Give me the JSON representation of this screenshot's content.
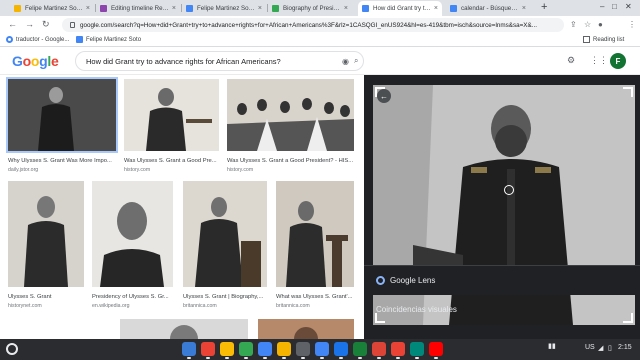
{
  "browser": {
    "tabs": [
      {
        "title": "Felipe Martinez Soto - Lo",
        "favicon_color": "#f4b400",
        "active": false
      },
      {
        "title": "Editing timeline Recons",
        "favicon_color": "#8e44ad",
        "active": false
      },
      {
        "title": "Felipe Martinez Soto - G",
        "favicon_color": "#4285f4",
        "active": false
      },
      {
        "title": "Biography of President",
        "favicon_color": "#34a853",
        "active": false
      },
      {
        "title": "How did Grant try to adv",
        "favicon_color": "#4285f4",
        "active": true
      },
      {
        "title": "calendar - Búsqueda de",
        "favicon_color": "#4285f4",
        "active": false
      }
    ],
    "new_tab_symbol": "+",
    "url": "google.com/search?q=How+did+Grant+try+to+advance+rights+for+African+Americans%3F&rlz=1CASQGI_enUS924&hl=es-419&tbm=isch&source=lnms&sa=X&...",
    "reading_list": "Reading list",
    "bookmarks": [
      {
        "label": "traductor - Google...",
        "icon_color": "#4285f4"
      },
      {
        "label": "Felipe Martinez Soto",
        "icon_color": "#4285f4"
      }
    ]
  },
  "google": {
    "logo": "Google",
    "logo_colors": [
      "#4285f4",
      "#ea4335",
      "#fbbc05",
      "#4285f4",
      "#34a853",
      "#ea4335"
    ],
    "query": "How did Grant try to advance rights for African Americans?",
    "avatar_initial": "F",
    "avatar_color": "#137333"
  },
  "results": [
    {
      "title": "Why Ulysses S. Grant Was More Impo...",
      "source": "daily.jstor.org"
    },
    {
      "title": "Was Ulysses S. Grant a Good Pre...",
      "source": "history.com"
    },
    {
      "title": "Was Ulysses S. Grant a Good President? - HIS...",
      "source": "history.com"
    },
    {
      "title": "Ulysses S. Grant",
      "source": "historynet.com"
    },
    {
      "title": "Presidency of Ulysses S. Gr...",
      "source": "en.wikipedia.org"
    },
    {
      "title": "Ulysses S. Grant | Biography,...",
      "source": "britannica.com"
    },
    {
      "title": "What was Ulysses S. Grant'...",
      "source": "britannica.com"
    }
  ],
  "panel": {
    "lens_label": "Google Lens",
    "visual_matches": "Coincidencias visuales"
  },
  "taskbar": {
    "apps": [
      {
        "name": "chrome-app",
        "color": "#3a7bd5"
      },
      {
        "name": "docs-app",
        "color": "#ea4335"
      },
      {
        "name": "drive-app",
        "color": "#fbbc05"
      },
      {
        "name": "sheets-app",
        "color": "#34a853"
      },
      {
        "name": "slides-app",
        "color": "#4285f4"
      },
      {
        "name": "classroom-app",
        "color": "#f4b400"
      },
      {
        "name": "files-app",
        "color": "#5f6368"
      },
      {
        "name": "docs-blue-app",
        "color": "#4285f4"
      },
      {
        "name": "calendar-app",
        "color": "#1a73e8"
      },
      {
        "name": "sheets2-app",
        "color": "#188038"
      },
      {
        "name": "chrome2-app",
        "color": "#db4437"
      },
      {
        "name": "gmail-app",
        "color": "#ea4335"
      },
      {
        "name": "meet-app",
        "color": "#00897b"
      },
      {
        "name": "youtube-app",
        "color": "#ff0000"
      }
    ],
    "locale": "US",
    "time": "2:15"
  }
}
